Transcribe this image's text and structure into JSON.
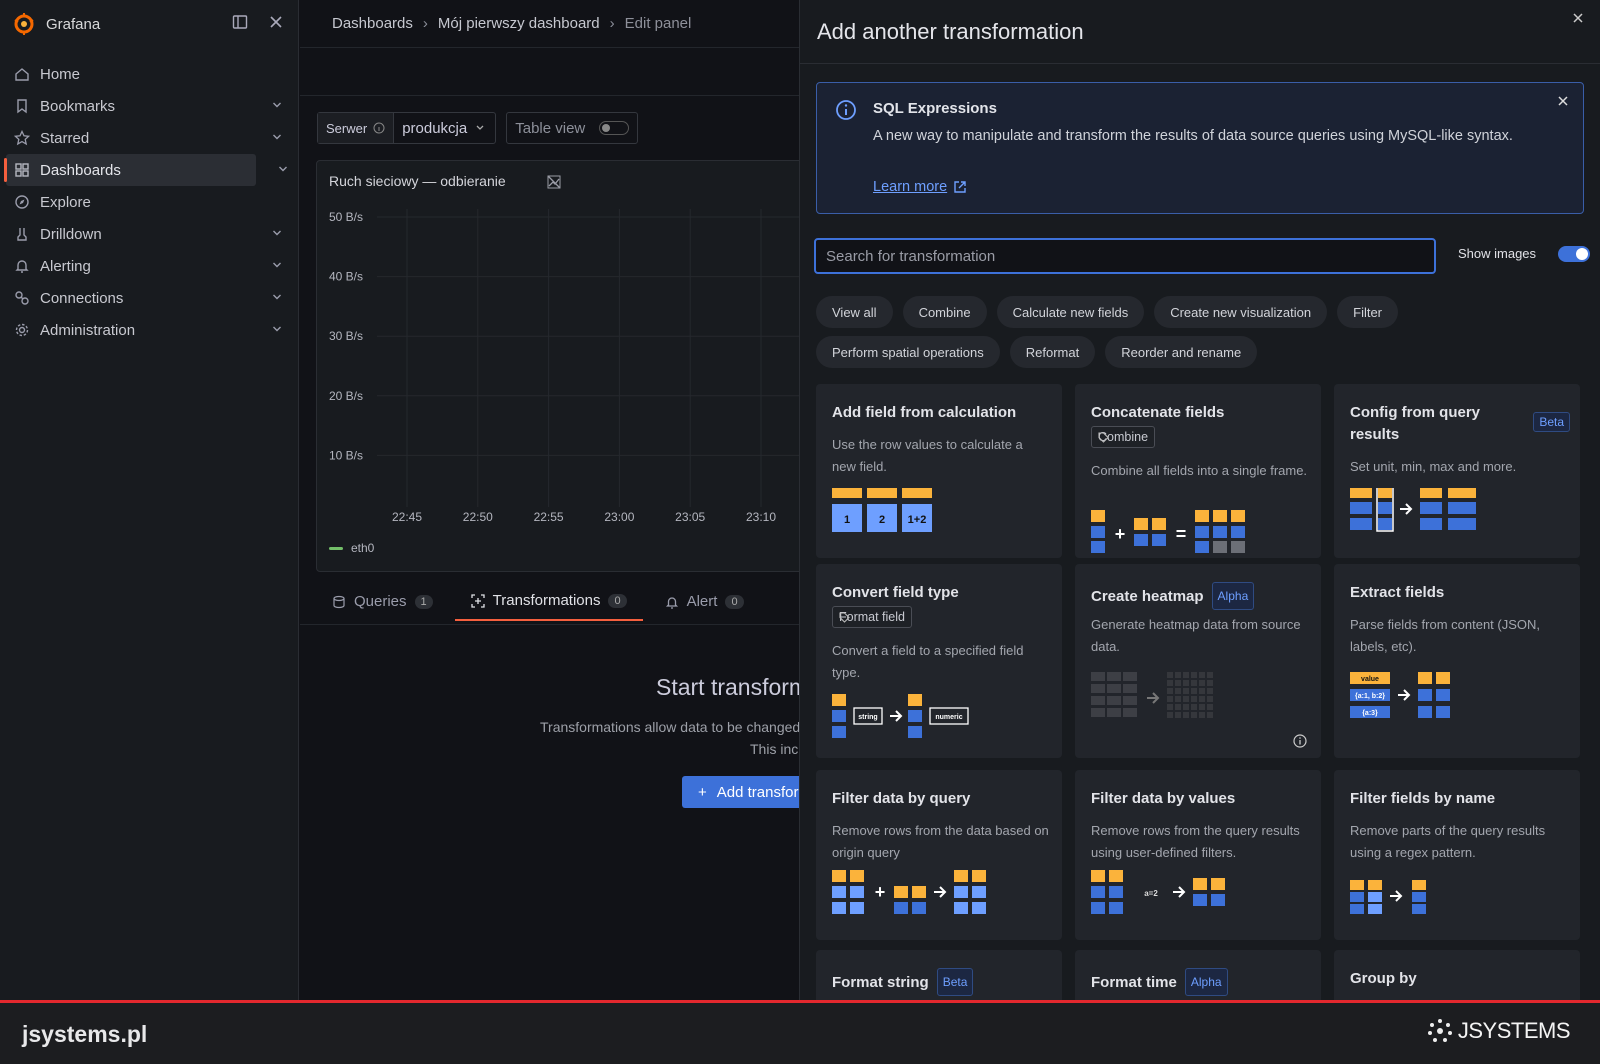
{
  "app": {
    "brand": "Grafana"
  },
  "sidebar": {
    "items": [
      {
        "label": "Home",
        "icon": "home-icon",
        "chevron": false
      },
      {
        "label": "Bookmarks",
        "icon": "bookmark-icon",
        "chevron": true
      },
      {
        "label": "Starred",
        "icon": "star-icon",
        "chevron": true
      },
      {
        "label": "Dashboards",
        "icon": "apps-icon",
        "chevron": true,
        "active": true
      },
      {
        "label": "Explore",
        "icon": "compass-icon",
        "chevron": false
      },
      {
        "label": "Drilldown",
        "icon": "drilldown-icon",
        "chevron": true
      },
      {
        "label": "Alerting",
        "icon": "bell-icon",
        "chevron": true
      },
      {
        "label": "Connections",
        "icon": "connections-icon",
        "chevron": true
      },
      {
        "label": "Administration",
        "icon": "cog-icon",
        "chevron": true
      }
    ]
  },
  "breadcrumb": {
    "items": [
      "Dashboards",
      "Mój pierwszy dashboard",
      "Edit panel"
    ]
  },
  "panel_controls": {
    "variable_label": "Serwer",
    "variable_value": "produkcja",
    "table_view_label": "Table view",
    "table_view_on": false
  },
  "panel": {
    "title": "Ruch sieciowy — odbieranie",
    "legend": "eth0"
  },
  "chart_data": {
    "type": "line",
    "title": "Ruch sieciowy — odbieranie",
    "y_ticks": [
      "50 B/s",
      "40 B/s",
      "30 B/s",
      "20 B/s",
      "10 B/s"
    ],
    "x_ticks": [
      "22:45",
      "22:50",
      "22:55",
      "23:00",
      "23:05",
      "23:10"
    ],
    "series": [
      {
        "name": "eth0",
        "color": "#73bf69",
        "values": []
      }
    ],
    "grid": true,
    "legend_position": "bottom-left"
  },
  "tabs": [
    {
      "label": "Queries",
      "count": "1",
      "icon": "database-icon"
    },
    {
      "label": "Transformations",
      "count": "0",
      "icon": "transform-icon",
      "active": true
    },
    {
      "label": "Alert",
      "count": "0",
      "icon": "bell-icon"
    }
  ],
  "empty_state": {
    "title": "Start transforming data",
    "line1": "Transformations allow data to be changed in various ways before your visualization is shown.",
    "line2": "This includes joining data together, renaming fields, making calculations, formatting data for display, and more.",
    "button": "Add transformation"
  },
  "drawer": {
    "title": "Add another transformation",
    "info": {
      "title": "SQL Expressions",
      "text": "A new way to manipulate and transform the results of data source queries using MySQL-like syntax.",
      "link": "Learn more"
    },
    "search_placeholder": "Search for transformation",
    "show_images_label": "Show images",
    "show_images_on": true,
    "chips": [
      "View all",
      "Combine",
      "Calculate new fields",
      "Create new visualization",
      "Filter",
      "Perform spatial operations",
      "Reformat",
      "Reorder and rename"
    ],
    "cards": [
      {
        "title": "Add field from calculation",
        "badge": "",
        "tag": "",
        "desc": "Use the row values to calculate a new field."
      },
      {
        "title": "Concatenate fields",
        "badge": "",
        "tag": "Combine",
        "desc": "Combine all fields into a single frame."
      },
      {
        "title": "Config from query results",
        "badge": "Beta",
        "tag": "",
        "desc": "Set unit, min, max and more."
      },
      {
        "title": "Convert field type",
        "badge": "",
        "tag": "Format field",
        "desc": "Convert a field to a specified field type."
      },
      {
        "title": "Create heatmap",
        "badge": "Alpha",
        "tag": "",
        "desc": "Generate heatmap data from source data."
      },
      {
        "title": "Extract fields",
        "badge": "",
        "tag": "",
        "desc": "Parse fields from content (JSON, labels, etc)."
      },
      {
        "title": "Filter data by query",
        "badge": "",
        "tag": "",
        "desc": "Remove rows from the data based on origin query"
      },
      {
        "title": "Filter data by values",
        "badge": "",
        "tag": "",
        "desc": "Remove rows from the query results using user-defined filters."
      },
      {
        "title": "Filter fields by name",
        "badge": "",
        "tag": "",
        "desc": "Remove parts of the query results using a regex pattern."
      },
      {
        "title": "Format string",
        "badge": "Beta",
        "tag": "",
        "desc": ""
      },
      {
        "title": "Format time",
        "badge": "Alpha",
        "tag": "",
        "desc": ""
      },
      {
        "title": "Group by",
        "badge": "",
        "tag": "",
        "desc": ""
      }
    ],
    "illustration_text": {
      "calc": [
        "1",
        "2",
        "1+2"
      ],
      "convert": [
        "string",
        "numeric"
      ],
      "extract": [
        "value",
        "{a:1, b:2}",
        "{a:3}"
      ],
      "filter_value": "a=2"
    }
  },
  "footer": {
    "left": "jsystems.pl",
    "logo": "JSYSTEMS"
  }
}
